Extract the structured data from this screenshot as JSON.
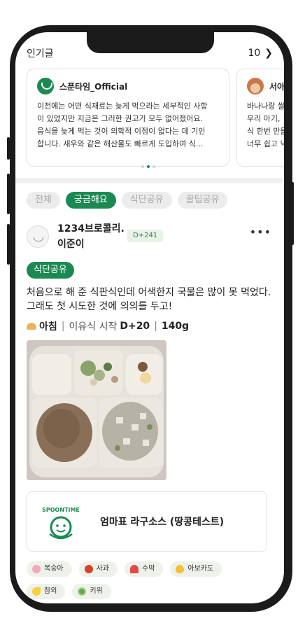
{
  "popular": {
    "title": "인기글",
    "count": "10",
    "cards": [
      {
        "author": "스푼타임_Official",
        "lines": [
          "이전에는 어떤 식재료는 늦게 먹으라는 세부적인 사항",
          "이 있었지만 지금은 그러한 권고가 모두 없어졌어요.",
          "음식을 늦게 먹는 것이 의학적 이점이 없다는 데 기인",
          "합니다. 새우와 같은 해산물도 빠르게 도입하여 식..."
        ]
      },
      {
        "author": "서아",
        "lines": [
          "바나나랑 쌀",
          "우리 아기,",
          "식 한번 만들",
          "너무 쉽고 넉"
        ]
      }
    ]
  },
  "tabs": [
    "전체",
    "궁금해요",
    "식단공유",
    "꿀팁공유"
  ],
  "post": {
    "username_line1": "1234브로콜리.",
    "username_line2": "이준이",
    "dday": "D+241",
    "category": "식단공유",
    "text_line1": "처음으로 해 준 식판식인데 어색한지 국물은 많이 못 먹었다.",
    "text_line2": "그래도 첫 시도한 것에 의의를 두고!",
    "meal": "아침",
    "separator": "|",
    "start_label": "이유식 시작",
    "start_value": "D+20",
    "amount": "140g",
    "product_name": "엄마표 라구소스 (땅콩테스트)",
    "product_logo_text": "SPOONTIME"
  },
  "ingredients_row1": [
    {
      "label": "복숭아",
      "color": "#f4a7c0"
    },
    {
      "label": "사과",
      "color": "#d9412b"
    },
    {
      "label": "수박",
      "color": "#e04a4a"
    },
    {
      "label": "아보카도",
      "color": "#f1c232"
    }
  ],
  "ingredients_row2": [
    {
      "label": "참외",
      "color": "#f6d23a"
    },
    {
      "label": "키위",
      "color": "#6aa84f"
    }
  ],
  "colors": {
    "brand": "#1a8a52"
  }
}
